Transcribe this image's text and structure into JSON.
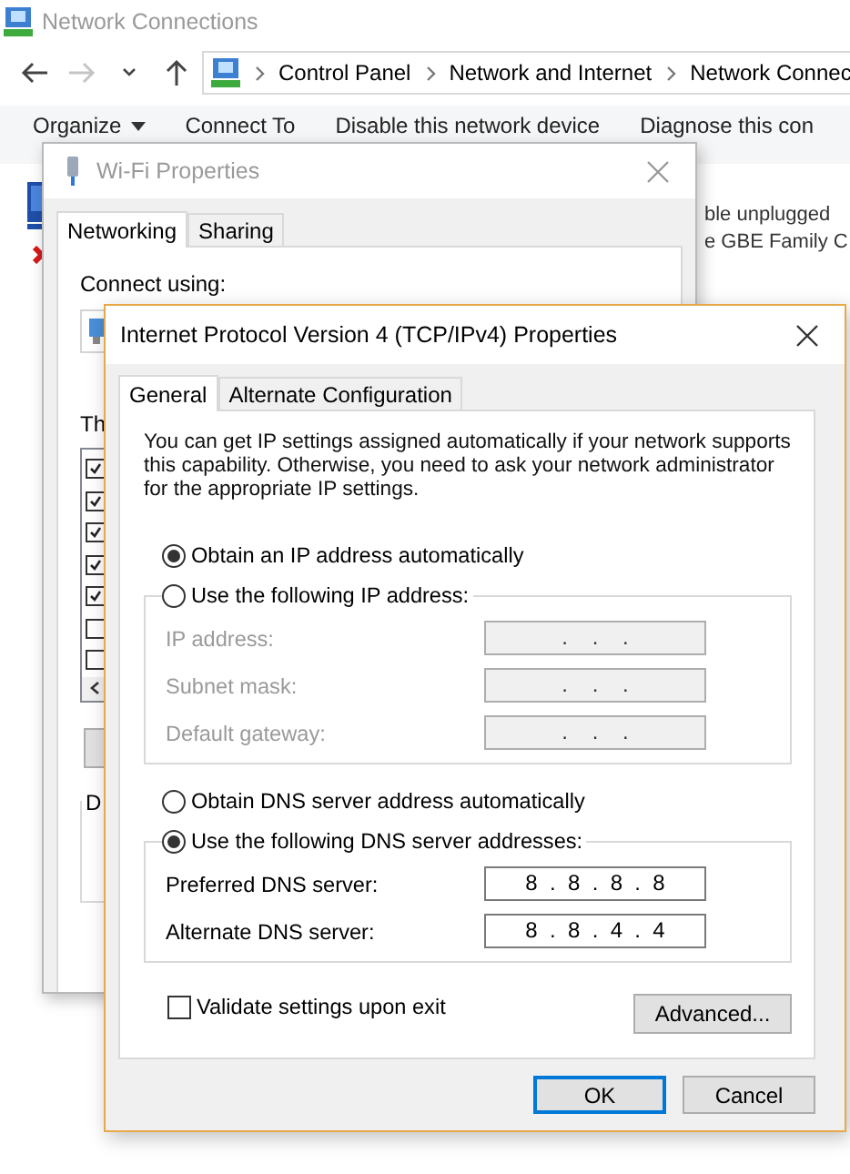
{
  "explorer": {
    "title": "Network Connections",
    "nav": [
      {
        "kind": "back",
        "disabled": false
      },
      {
        "kind": "forward",
        "disabled": true
      },
      {
        "kind": "recent",
        "disabled": false
      },
      {
        "kind": "up",
        "disabled": false
      }
    ],
    "breadcrumb": [
      "Control Panel",
      "Network and Internet",
      "Network Connec"
    ],
    "commands": [
      {
        "label": "Organize",
        "kind": "menu"
      },
      {
        "label": "Connect To",
        "kind": "action"
      },
      {
        "label": "Disable this network device",
        "kind": "action"
      },
      {
        "label": "Diagnose this con",
        "kind": "action"
      }
    ],
    "statuses": [
      "ble unplugged",
      "e GBE Family C"
    ]
  },
  "wifi_properties": {
    "title": "Wi-Fi Properties",
    "tabs": [
      {
        "label": "Networking",
        "selected": true
      },
      {
        "label": "Sharing",
        "selected": false
      }
    ],
    "connect_using": "Connect using:",
    "list_label": "Th",
    "components": [
      {
        "checked": true
      },
      {
        "checked": true
      },
      {
        "checked": true
      },
      {
        "checked": true
      },
      {
        "checked": true
      },
      {
        "checked": false
      },
      {
        "checked": false
      }
    ],
    "group_label": "D"
  },
  "ipv4_properties": {
    "title": "Internet Protocol Version 4 (TCP/IPv4) Properties",
    "tabs": [
      {
        "label": "General",
        "selected": true
      },
      {
        "label": "Alternate Configuration",
        "selected": false
      }
    ],
    "description": "You can get IP settings assigned automatically if your network supports\nthis capability. Otherwise, you need to ask your network administrator\nfor the appropriate IP settings.",
    "ip_options": [
      {
        "label": "Obtain an IP address automatically",
        "selected": true
      },
      {
        "label": "Use the following IP address:",
        "selected": false
      }
    ],
    "ip_fields": [
      {
        "label": "IP address:",
        "value": ".    .    .",
        "disabled": true
      },
      {
        "label": "Subnet mask:",
        "value": ".    .    .",
        "disabled": true
      },
      {
        "label": "Default gateway:",
        "value": ".    .    .",
        "disabled": true
      }
    ],
    "dns_options": [
      {
        "label": "Obtain DNS server address automatically",
        "selected": false
      },
      {
        "label": "Use the following DNS server addresses:",
        "selected": true
      }
    ],
    "dns_fields": [
      {
        "label": "Preferred DNS server:",
        "value": "8  .  8  .  8  .  8",
        "disabled": false
      },
      {
        "label": "Alternate DNS server:",
        "value": "8  .  8  .  4  .  4",
        "disabled": false
      }
    ],
    "validate": {
      "label": "Validate settings upon exit",
      "checked": false
    },
    "advanced_button": "Advanced...",
    "buttons": [
      {
        "label": "OK",
        "default": true
      },
      {
        "label": "Cancel",
        "default": false
      }
    ]
  }
}
